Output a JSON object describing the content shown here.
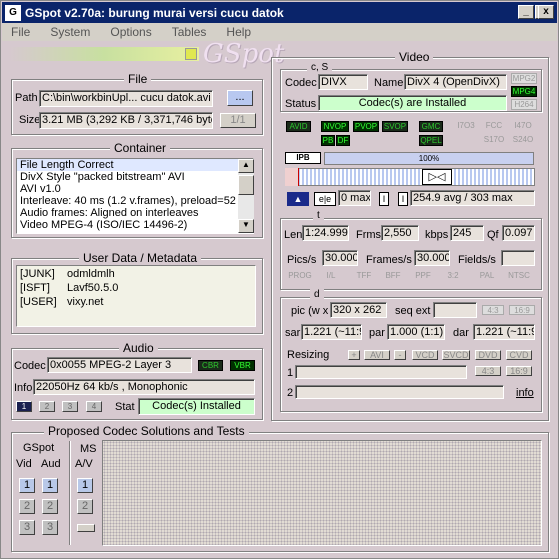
{
  "window": {
    "title": "GSpot v2.70a: burung murai versi cucu datok",
    "minimize": "_",
    "maximize": "□",
    "close": "x"
  },
  "menu": [
    "File",
    "System",
    "Options",
    "Tables",
    "Help"
  ],
  "file": {
    "title": "File",
    "path_label": "Path",
    "path": "C:\\bin\\workbinUpl... cucu datok.avi",
    "browse": "...",
    "size_label": "Size",
    "size": "3.21 MB (3,292 KB / 3,371,746 byte",
    "pager": "1/1"
  },
  "container": {
    "title": "Container",
    "lines": [
      "File Length Correct",
      "DivX Style \"packed bitstream\" AVI",
      "AVI v1.0",
      "Interleave: 40 ms (1.2 v.frames), preload=52",
      "Audio frames: Aligned on interleaves",
      "Video MPEG-4 (ISO/IEC 14496-2)"
    ]
  },
  "userdata": {
    "title": "User Data / Metadata",
    "rows": [
      {
        "k": "[JUNK]",
        "v": "odmldmlh"
      },
      {
        "k": "[ISFT]",
        "v": "Lavf50.5.0"
      },
      {
        "k": "[USER]",
        "v": "vixy.net"
      }
    ]
  },
  "audio": {
    "title": "Audio",
    "codec_label": "Codec",
    "codec": "0x0055  MPEG-2 Layer 3",
    "cbr": "CBR",
    "vbr": "VBR",
    "info_label": "Info",
    "info": "22050Hz  64 kb/s , Monophonic",
    "tabs": [
      "1",
      "2",
      "3",
      "4"
    ],
    "stat_label": "Stat",
    "stat": "Codec(s) Installed"
  },
  "proposed": {
    "title": "Proposed Codec Solutions and Tests",
    "gspot": "GSpot",
    "vid": "Vid",
    "aud": "Aud",
    "ms": "MS",
    "av": "A/V",
    "nums": [
      "1",
      "2",
      "3"
    ]
  },
  "video": {
    "title": "Video",
    "cs": {
      "title": "c, S",
      "codec_label": "Codec",
      "codec": "DIVX",
      "name_label": "Name",
      "name": "DivX 4 (OpenDivX)",
      "status_label": "Status",
      "status": "Codec(s) are Installed",
      "badges": [
        "MPG2",
        "MPG4",
        "H264"
      ]
    },
    "flags1": [
      "AVID",
      "NVOP",
      "PVOP",
      "SVOP",
      "GMC",
      "QPEL"
    ],
    "flags2": [
      "PB",
      "DF"
    ],
    "flags3": [
      "I7O3",
      "FCC",
      "I47O",
      "S17O",
      "S24O"
    ],
    "frames": {
      "ipb": "IPB",
      "pct": "100%"
    },
    "bitrate": {
      "ee": "0 max",
      "avg": "254.9 avg / 303 max"
    },
    "t": {
      "title": "t",
      "len_label": "Len",
      "len": "1:24.999",
      "frms_label": "Frms",
      "frms": "2,550",
      "kbps": "245",
      "kbps_label": "kbps",
      "qf_label": "Qf",
      "qf": "0.097",
      "pics_label": "Pics/s",
      "pics": "30.000",
      "frames_label": "Frames/s",
      "frames": "30.000",
      "fields_label": "Fields/s",
      "fields": "",
      "tags": [
        "PROG",
        "I/L",
        "TFF",
        "BFF",
        "PPF",
        "3:2",
        "PAL",
        "NTSC"
      ]
    },
    "d": {
      "title": "d",
      "pic_label": "pic (w x",
      "pic": "320 x 262",
      "seqext_label": "seq ext",
      "seqext": "",
      "r43": "4:3",
      "r169": "16:9",
      "sar_label": "sar",
      "sar": "1.221 (~11:9)",
      "par_label": "par",
      "par": "1.000 (1:1)",
      "dar_label": "dar",
      "dar": "1.221 (~11:9)"
    },
    "resize": {
      "label": "Resizing",
      "btns": [
        "+",
        "AVI",
        "-",
        "VCD",
        "SVCD",
        "DVD",
        "CVD"
      ],
      "r1": "1",
      "r2": "2",
      "b43": "4:3",
      "b169": "16:9",
      "info": "info"
    }
  }
}
